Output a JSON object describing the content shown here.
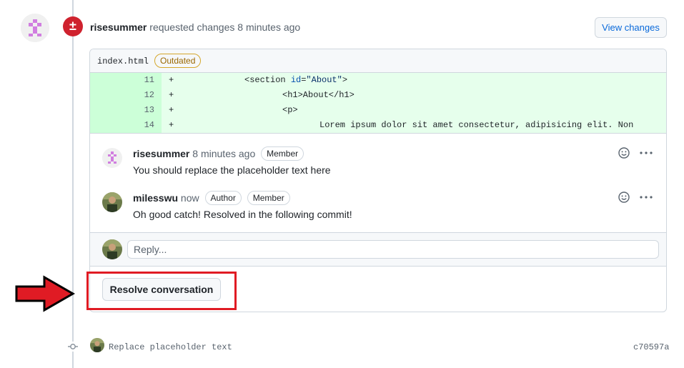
{
  "review": {
    "author": "risesummer",
    "action": "requested changes",
    "time": "8 minutes ago",
    "view_changes_label": "View changes",
    "badge_symbol": "±"
  },
  "file": {
    "name": "index.html",
    "status_badge": "Outdated",
    "lines": [
      {
        "num": "11",
        "sign": "+",
        "indent": "              ",
        "tag_open": "<section ",
        "attr": "id",
        "eq": "=",
        "val": "\"About\"",
        "tag_close": ">",
        "rest": ""
      },
      {
        "num": "12",
        "sign": "+",
        "indent": "                     ",
        "text": "<h1>About</h1>"
      },
      {
        "num": "13",
        "sign": "+",
        "indent": "                     ",
        "text": "<p>"
      },
      {
        "num": "14",
        "sign": "+",
        "indent": "                            ",
        "text": "Lorem ipsum dolor sit amet consectetur, adipisicing elit. Non"
      }
    ]
  },
  "comments": [
    {
      "author": "risesummer",
      "time": "8 minutes ago",
      "badges": [
        "Member"
      ],
      "body": "You should replace the placeholder text here"
    },
    {
      "author": "milesswu",
      "time": "now",
      "badges": [
        "Author",
        "Member"
      ],
      "body": "Oh good catch! Resolved in the following commit!"
    }
  ],
  "reply": {
    "placeholder": "Reply..."
  },
  "resolve_label": "Resolve conversation",
  "commit": {
    "message": "Replace placeholder text",
    "sha": "c70597a"
  },
  "colors": {
    "danger": "#cf222e",
    "link": "#0969da",
    "added_bg": "#e6ffec",
    "added_num_bg": "#ccffd8",
    "annotation_red": "#e01b24"
  },
  "icons": {
    "react": "smiley-icon",
    "menu": "kebab-horizontal-icon",
    "commit": "git-commit-icon",
    "request_changes": "file-diff-icon"
  }
}
